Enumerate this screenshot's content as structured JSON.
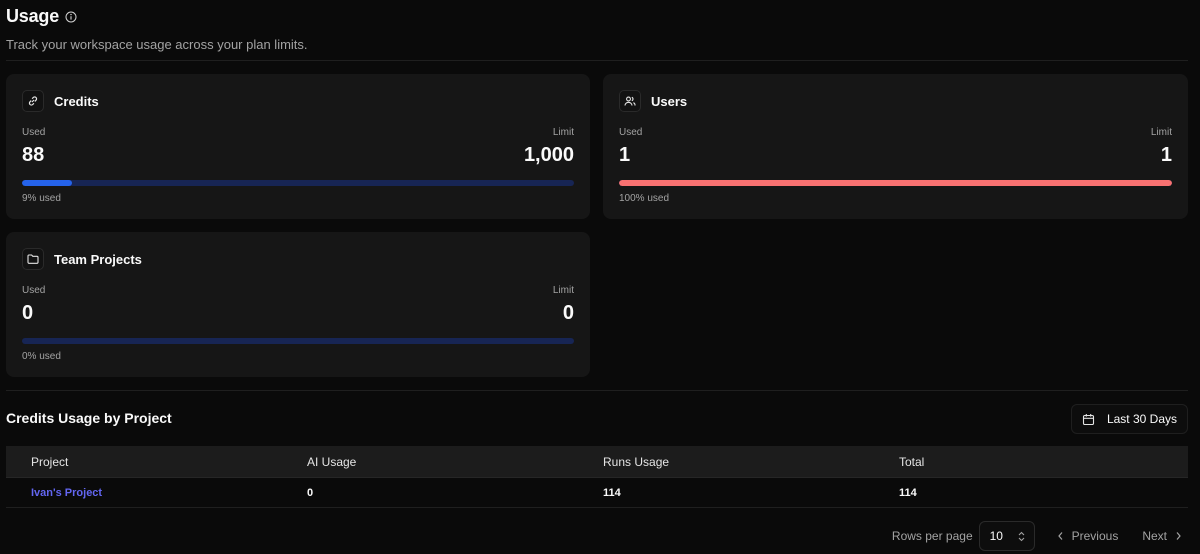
{
  "header": {
    "title": "Usage",
    "subtitle": "Track your workspace usage across your plan limits."
  },
  "cards": {
    "credits": {
      "title": "Credits",
      "used_label": "Used",
      "limit_label": "Limit",
      "used": "88",
      "limit": "1,000",
      "percent_text": "9% used",
      "fraction": 0.09,
      "fill_color": "#2563eb"
    },
    "users": {
      "title": "Users",
      "used_label": "Used",
      "limit_label": "Limit",
      "used": "1",
      "limit": "1",
      "percent_text": "100% used",
      "fraction": 1.0,
      "fill_color": "#f87171"
    },
    "team_projects": {
      "title": "Team Projects",
      "used_label": "Used",
      "limit_label": "Limit",
      "used": "0",
      "limit": "0",
      "percent_text": "0% used",
      "fraction": 0.0,
      "fill_color": "#2563eb"
    }
  },
  "credits_usage": {
    "title": "Credits Usage by Project",
    "date_range": "Last 30 Days",
    "columns": [
      "Project",
      "AI Usage",
      "Runs Usage",
      "Total"
    ],
    "rows": [
      {
        "project": "Ivan's Project",
        "ai_usage": "0",
        "runs_usage": "114",
        "total": "114"
      }
    ]
  },
  "pagination": {
    "rows_per_page_label": "Rows per page",
    "rows_per_page": "10",
    "previous": "Previous",
    "next": "Next"
  }
}
